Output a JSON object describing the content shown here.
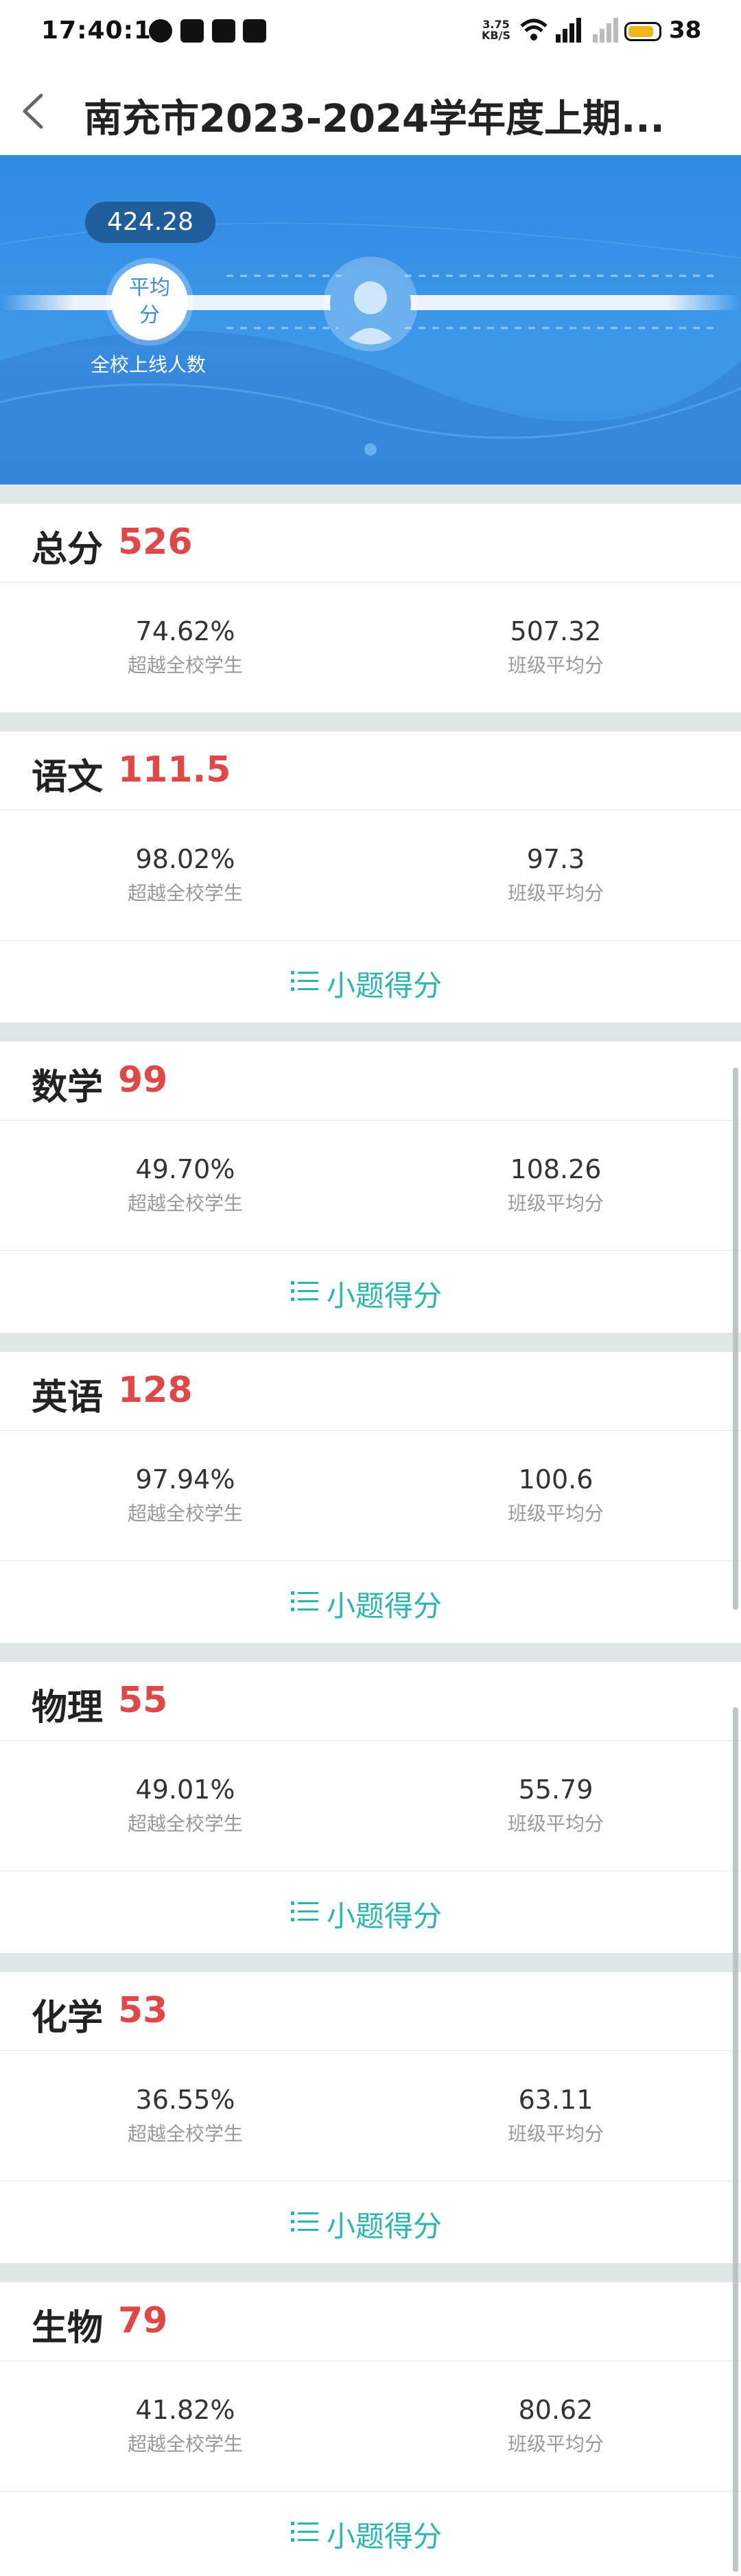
{
  "status_bar": {
    "time": "17:40:14",
    "speed_value": "3.75",
    "speed_unit": "KB/S",
    "battery": "38"
  },
  "nav": {
    "title": "南充市2023-2024学年度上期..."
  },
  "banner": {
    "avg_value": "424.28",
    "avg_label": "平均分",
    "caption": "全校上线人数"
  },
  "labels": {
    "beat_label": "超越全校学生",
    "class_avg_label": "班级平均分",
    "sub_score_label": "小题得分"
  },
  "cards": [
    {
      "subject": "总分",
      "score": "526",
      "beat": "74.62%",
      "class_avg": "507.32"
    },
    {
      "subject": "语文",
      "score": "111.5",
      "beat": "98.02%",
      "class_avg": "97.3"
    },
    {
      "subject": "数学",
      "score": "99",
      "beat": "49.70%",
      "class_avg": "108.26"
    },
    {
      "subject": "英语",
      "score": "128",
      "beat": "97.94%",
      "class_avg": "100.6"
    },
    {
      "subject": "物理",
      "score": "55",
      "beat": "49.01%",
      "class_avg": "55.79"
    },
    {
      "subject": "化学",
      "score": "53",
      "beat": "36.55%",
      "class_avg": "63.11"
    },
    {
      "subject": "生物",
      "score": "79",
      "beat": "41.82%",
      "class_avg": "80.62"
    }
  ],
  "colors": {
    "score": "#e04848",
    "accent": "#2bb5b0",
    "banner": "#3a90e6"
  }
}
